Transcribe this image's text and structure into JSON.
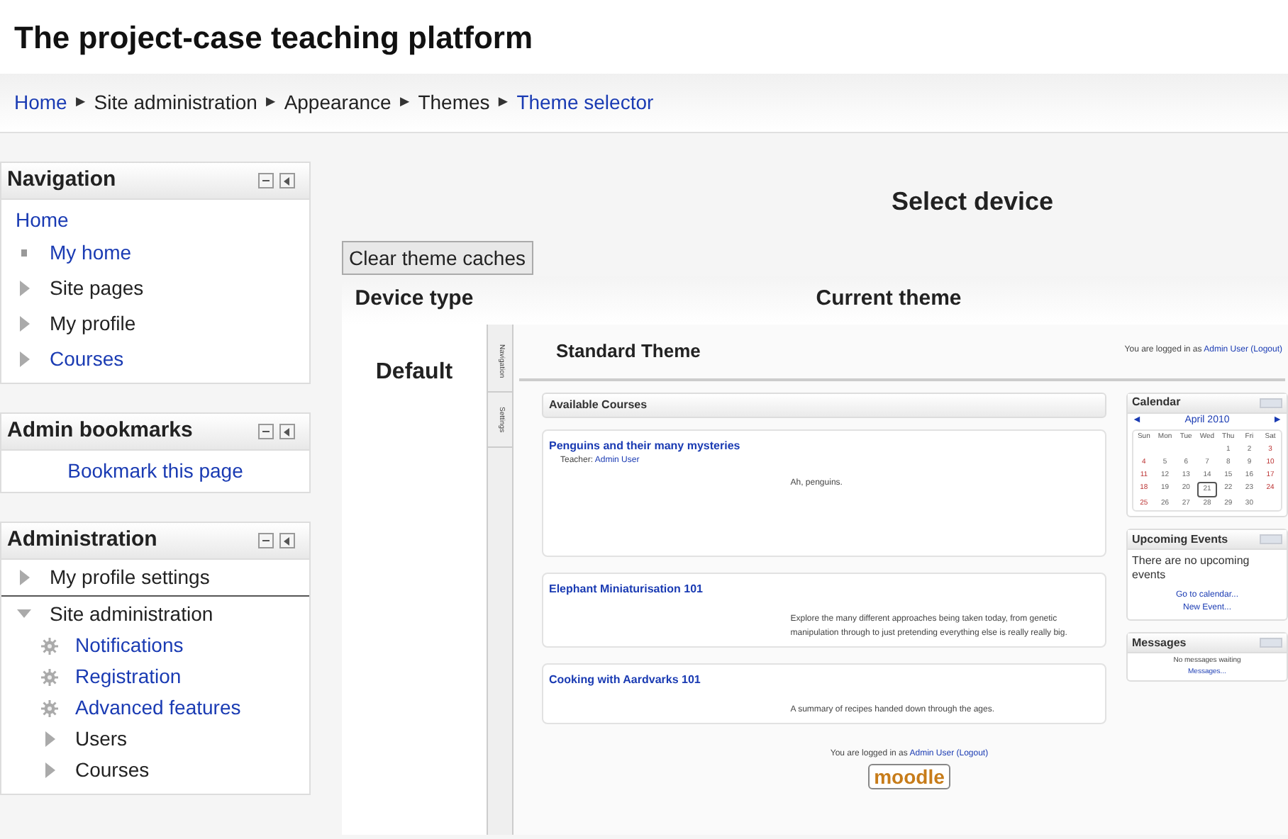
{
  "site_title": "The project-case teaching platform",
  "breadcrumb": [
    {
      "label": "Home",
      "link": true
    },
    {
      "label": "Site administration",
      "link": false
    },
    {
      "label": "Appearance",
      "link": false
    },
    {
      "label": "Themes",
      "link": false
    },
    {
      "label": "Theme selector",
      "link": true
    }
  ],
  "breadcrumb_separator": "►",
  "navigation": {
    "title": "Navigation",
    "home": "Home",
    "items": [
      {
        "label": "My home",
        "kind": "bullet",
        "link": true
      },
      {
        "label": "Site pages",
        "kind": "arrow",
        "link": false
      },
      {
        "label": "My profile",
        "kind": "arrow",
        "link": false
      },
      {
        "label": "Courses",
        "kind": "arrow",
        "link": true
      }
    ]
  },
  "admin_bookmarks": {
    "title": "Admin bookmarks",
    "link": "Bookmark this page"
  },
  "administration": {
    "title": "Administration",
    "items": [
      {
        "label": "My profile settings",
        "kind": "arrow",
        "expanded": false,
        "link": false
      },
      {
        "label": "Site administration",
        "kind": "arrow",
        "expanded": true,
        "link": false,
        "children": [
          {
            "label": "Notifications",
            "kind": "gear",
            "link": true
          },
          {
            "label": "Registration",
            "kind": "gear",
            "link": true
          },
          {
            "label": "Advanced features",
            "kind": "gear",
            "link": true
          },
          {
            "label": "Users",
            "kind": "arrow",
            "link": false
          },
          {
            "label": "Courses",
            "kind": "arrow",
            "link": false
          }
        ]
      }
    ]
  },
  "main": {
    "heading": "Select device",
    "clear_button": "Clear theme caches",
    "columns": [
      "Device type",
      "Current theme"
    ],
    "rows": [
      {
        "device": "Default",
        "preview": {
          "tabs": [
            "Navigation",
            "Settings"
          ],
          "title": "Standard Theme",
          "login": {
            "prefix": "You are logged in as",
            "user": "Admin User",
            "logout": "(Logout)"
          },
          "courses_heading": "Available Courses",
          "courses": [
            {
              "name": "Penguins and their many mysteries",
              "teacher_label": "Teacher:",
              "teacher": "Admin User",
              "summary": "Ah, penguins."
            },
            {
              "name": "Elephant Miniaturisation 101",
              "summary": "Explore the many different approaches being taken today, from genetic manipulation through to just pretending everything else is really really big."
            },
            {
              "name": "Cooking with Aardvarks 101",
              "summary": "A summary of recipes handed down through the ages."
            }
          ],
          "footer_login": {
            "prefix": "You are logged in as",
            "user": "Admin User",
            "logout": "(Logout)"
          },
          "logo": "moodle",
          "calendar": {
            "title": "Calendar",
            "prev": "◄",
            "month": "April 2010",
            "next": "►",
            "weekdays": [
              "Sun",
              "Mon",
              "Tue",
              "Wed",
              "Thu",
              "Fri",
              "Sat"
            ],
            "weeks": [
              [
                {
                  "d": "1",
                  "today": false
                },
                {
                  "d": "2",
                  "today": false
                },
                {
                  "d": "3",
                  "today": false
                }
              ],
              [
                {
                  "d": "4",
                  "today": false
                },
                {
                  "d": "5",
                  "today": false
                },
                {
                  "d": "6",
                  "today": false
                },
                {
                  "d": "7",
                  "today": false
                },
                {
                  "d": "8",
                  "today": false
                },
                {
                  "d": "9",
                  "today": false
                },
                {
                  "d": "10",
                  "today": false
                }
              ],
              [
                {
                  "d": "11",
                  "today": false
                },
                {
                  "d": "12",
                  "today": false
                },
                {
                  "d": "13",
                  "today": false
                },
                {
                  "d": "14",
                  "today": false
                },
                {
                  "d": "15",
                  "today": false
                },
                {
                  "d": "16",
                  "today": false
                },
                {
                  "d": "17",
                  "today": false
                }
              ],
              [
                {
                  "d": "18",
                  "today": false
                },
                {
                  "d": "19",
                  "today": false
                },
                {
                  "d": "20",
                  "today": false
                },
                {
                  "d": "21",
                  "today": true
                },
                {
                  "d": "22",
                  "today": false
                },
                {
                  "d": "23",
                  "today": false
                },
                {
                  "d": "24",
                  "today": false
                }
              ],
              [
                {
                  "d": "25",
                  "today": false
                },
                {
                  "d": "26",
                  "today": false
                },
                {
                  "d": "27",
                  "today": false
                },
                {
                  "d": "28",
                  "today": false
                },
                {
                  "d": "29",
                  "today": false
                },
                {
                  "d": "30",
                  "today": false
                }
              ]
            ]
          },
          "upcoming": {
            "title": "Upcoming Events",
            "text": "There are no upcoming events",
            "links": [
              "Go to calendar...",
              "New Event..."
            ]
          },
          "messages": {
            "title": "Messages",
            "text": "No messages waiting",
            "link": "Messages..."
          }
        }
      }
    ]
  }
}
